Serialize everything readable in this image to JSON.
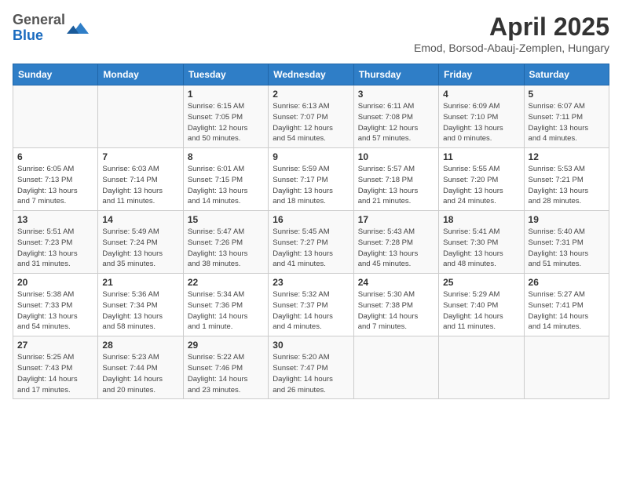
{
  "header": {
    "logo_general": "General",
    "logo_blue": "Blue",
    "month_title": "April 2025",
    "location": "Emod, Borsod-Abauj-Zemplen, Hungary"
  },
  "days_of_week": [
    "Sunday",
    "Monday",
    "Tuesday",
    "Wednesday",
    "Thursday",
    "Friday",
    "Saturday"
  ],
  "weeks": [
    [
      {
        "day": "",
        "info": ""
      },
      {
        "day": "",
        "info": ""
      },
      {
        "day": "1",
        "info": "Sunrise: 6:15 AM\nSunset: 7:05 PM\nDaylight: 12 hours\nand 50 minutes."
      },
      {
        "day": "2",
        "info": "Sunrise: 6:13 AM\nSunset: 7:07 PM\nDaylight: 12 hours\nand 54 minutes."
      },
      {
        "day": "3",
        "info": "Sunrise: 6:11 AM\nSunset: 7:08 PM\nDaylight: 12 hours\nand 57 minutes."
      },
      {
        "day": "4",
        "info": "Sunrise: 6:09 AM\nSunset: 7:10 PM\nDaylight: 13 hours\nand 0 minutes."
      },
      {
        "day": "5",
        "info": "Sunrise: 6:07 AM\nSunset: 7:11 PM\nDaylight: 13 hours\nand 4 minutes."
      }
    ],
    [
      {
        "day": "6",
        "info": "Sunrise: 6:05 AM\nSunset: 7:13 PM\nDaylight: 13 hours\nand 7 minutes."
      },
      {
        "day": "7",
        "info": "Sunrise: 6:03 AM\nSunset: 7:14 PM\nDaylight: 13 hours\nand 11 minutes."
      },
      {
        "day": "8",
        "info": "Sunrise: 6:01 AM\nSunset: 7:15 PM\nDaylight: 13 hours\nand 14 minutes."
      },
      {
        "day": "9",
        "info": "Sunrise: 5:59 AM\nSunset: 7:17 PM\nDaylight: 13 hours\nand 18 minutes."
      },
      {
        "day": "10",
        "info": "Sunrise: 5:57 AM\nSunset: 7:18 PM\nDaylight: 13 hours\nand 21 minutes."
      },
      {
        "day": "11",
        "info": "Sunrise: 5:55 AM\nSunset: 7:20 PM\nDaylight: 13 hours\nand 24 minutes."
      },
      {
        "day": "12",
        "info": "Sunrise: 5:53 AM\nSunset: 7:21 PM\nDaylight: 13 hours\nand 28 minutes."
      }
    ],
    [
      {
        "day": "13",
        "info": "Sunrise: 5:51 AM\nSunset: 7:23 PM\nDaylight: 13 hours\nand 31 minutes."
      },
      {
        "day": "14",
        "info": "Sunrise: 5:49 AM\nSunset: 7:24 PM\nDaylight: 13 hours\nand 35 minutes."
      },
      {
        "day": "15",
        "info": "Sunrise: 5:47 AM\nSunset: 7:26 PM\nDaylight: 13 hours\nand 38 minutes."
      },
      {
        "day": "16",
        "info": "Sunrise: 5:45 AM\nSunset: 7:27 PM\nDaylight: 13 hours\nand 41 minutes."
      },
      {
        "day": "17",
        "info": "Sunrise: 5:43 AM\nSunset: 7:28 PM\nDaylight: 13 hours\nand 45 minutes."
      },
      {
        "day": "18",
        "info": "Sunrise: 5:41 AM\nSunset: 7:30 PM\nDaylight: 13 hours\nand 48 minutes."
      },
      {
        "day": "19",
        "info": "Sunrise: 5:40 AM\nSunset: 7:31 PM\nDaylight: 13 hours\nand 51 minutes."
      }
    ],
    [
      {
        "day": "20",
        "info": "Sunrise: 5:38 AM\nSunset: 7:33 PM\nDaylight: 13 hours\nand 54 minutes."
      },
      {
        "day": "21",
        "info": "Sunrise: 5:36 AM\nSunset: 7:34 PM\nDaylight: 13 hours\nand 58 minutes."
      },
      {
        "day": "22",
        "info": "Sunrise: 5:34 AM\nSunset: 7:36 PM\nDaylight: 14 hours\nand 1 minute."
      },
      {
        "day": "23",
        "info": "Sunrise: 5:32 AM\nSunset: 7:37 PM\nDaylight: 14 hours\nand 4 minutes."
      },
      {
        "day": "24",
        "info": "Sunrise: 5:30 AM\nSunset: 7:38 PM\nDaylight: 14 hours\nand 7 minutes."
      },
      {
        "day": "25",
        "info": "Sunrise: 5:29 AM\nSunset: 7:40 PM\nDaylight: 14 hours\nand 11 minutes."
      },
      {
        "day": "26",
        "info": "Sunrise: 5:27 AM\nSunset: 7:41 PM\nDaylight: 14 hours\nand 14 minutes."
      }
    ],
    [
      {
        "day": "27",
        "info": "Sunrise: 5:25 AM\nSunset: 7:43 PM\nDaylight: 14 hours\nand 17 minutes."
      },
      {
        "day": "28",
        "info": "Sunrise: 5:23 AM\nSunset: 7:44 PM\nDaylight: 14 hours\nand 20 minutes."
      },
      {
        "day": "29",
        "info": "Sunrise: 5:22 AM\nSunset: 7:46 PM\nDaylight: 14 hours\nand 23 minutes."
      },
      {
        "day": "30",
        "info": "Sunrise: 5:20 AM\nSunset: 7:47 PM\nDaylight: 14 hours\nand 26 minutes."
      },
      {
        "day": "",
        "info": ""
      },
      {
        "day": "",
        "info": ""
      },
      {
        "day": "",
        "info": ""
      }
    ]
  ]
}
